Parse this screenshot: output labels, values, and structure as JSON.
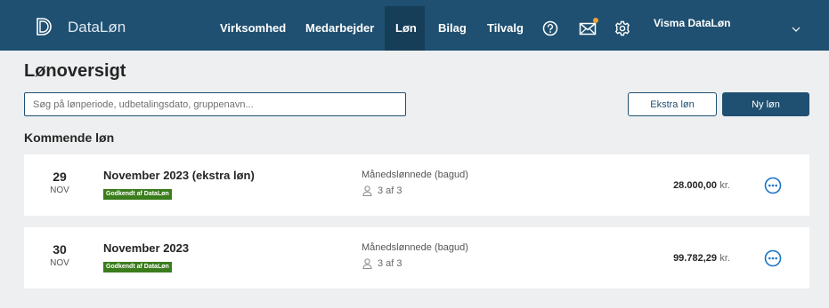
{
  "app": {
    "brand": "DataLøn"
  },
  "nav": {
    "items": [
      "Virksomhed",
      "Medarbejder",
      "Løn",
      "Bilag",
      "Tilvalg"
    ],
    "active": "Løn"
  },
  "account": {
    "name": "Visma DataLøn"
  },
  "page": {
    "title": "Lønoversigt"
  },
  "search": {
    "placeholder": "Søg på lønperiode, udbetalingsdato, gruppenavn..."
  },
  "actions": {
    "extra_label": "Ekstra løn",
    "new_label": "Ny løn"
  },
  "section": {
    "upcoming_title": "Kommende løn"
  },
  "payruns": [
    {
      "day": "29",
      "month": "NOV",
      "title": "November 2023 (ekstra løn)",
      "badge": "Godkendt af DataLøn",
      "group": "Månedslønnede (bagud)",
      "count": "3 af 3",
      "amount": "28.000,00",
      "unit": "kr."
    },
    {
      "day": "30",
      "month": "NOV",
      "title": "November 2023",
      "badge": "Godkendt af DataLøn",
      "group": "Månedslønnede (bagud)",
      "count": "3 af 3",
      "amount": "99.782,29",
      "unit": "kr."
    }
  ],
  "colors": {
    "header": "#1f5071",
    "header_active": "#173e58",
    "badge": "#3b7d1d",
    "notification": "#f2a333",
    "accent": "#1f5071"
  },
  "icons": [
    "datalon-logo-icon",
    "help-icon",
    "mail-icon",
    "settings-gear-icon",
    "chevron-down-icon",
    "person-icon",
    "more-options-icon"
  ]
}
